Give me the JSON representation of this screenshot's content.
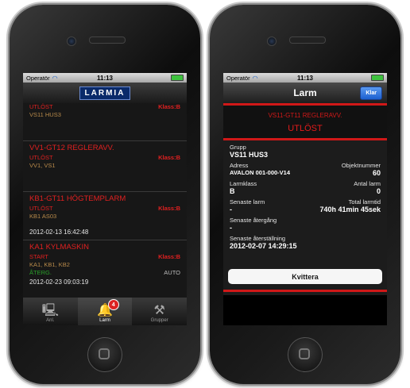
{
  "status": {
    "operator": "Operatör",
    "time": "11:13"
  },
  "left": {
    "logo": "LARMIA",
    "alarms": [
      {
        "title": "",
        "state": "UTLÖST",
        "class": "Klass:B",
        "objects": "VS11 HUS3",
        "date": "",
        "extra": "",
        "auto": ""
      },
      {
        "title": "VV1-GT12 REGLERAVV.",
        "state": "UTLÖST",
        "class": "Klass:B",
        "objects": "VV1, VS1",
        "date": "",
        "extra": "",
        "auto": ""
      },
      {
        "title": "KB1-GT11 HÖGTEMPLARM",
        "state": "UTLÖST",
        "class": "Klass:B",
        "objects": "KB1 AS03",
        "date": "2012-02-13 16:42:48",
        "extra": "",
        "auto": ""
      },
      {
        "title": "KA1 KYLMASKIN",
        "state": "START",
        "class": "Klass:B",
        "objects": "KA1, KB1, KB2",
        "date": "2012-02-23 09:03:19",
        "extra": "ÅTERG.",
        "auto": "AUTO"
      }
    ],
    "tabs": [
      {
        "label": "Anl.",
        "icon": "computer-icon"
      },
      {
        "label": "Larm",
        "icon": "bell-icon",
        "badge": "4"
      },
      {
        "label": "Grupper",
        "icon": "tools-icon"
      }
    ]
  },
  "right": {
    "title": "Larm",
    "done_button": "Klar",
    "object": "VS11-GT11 REGLERAVV.",
    "state": "UTLÖST",
    "group_label": "Grupp",
    "group_value": "VS11 HUS3",
    "address_label": "Adress",
    "address_value": "AVALON 001-000-V14",
    "objnum_label": "Objektnummer",
    "objnum_value": "60",
    "class_label": "Larmklass",
    "class_value": "B",
    "count_label": "Antal larm",
    "count_value": "0",
    "last_label": "Senaste larm",
    "last_value": "-",
    "total_label": "Total larmtid",
    "total_value": "740h 41min 45sek",
    "return_label": "Senaste återgång",
    "return_value": "-",
    "reset_label": "Senaste återställning",
    "reset_value": "2012-02-07 14:29:15",
    "ack_button": "Kvittera"
  },
  "colors": {
    "alarm_red": "#e02020",
    "accent_blue": "#1c5fd0"
  }
}
